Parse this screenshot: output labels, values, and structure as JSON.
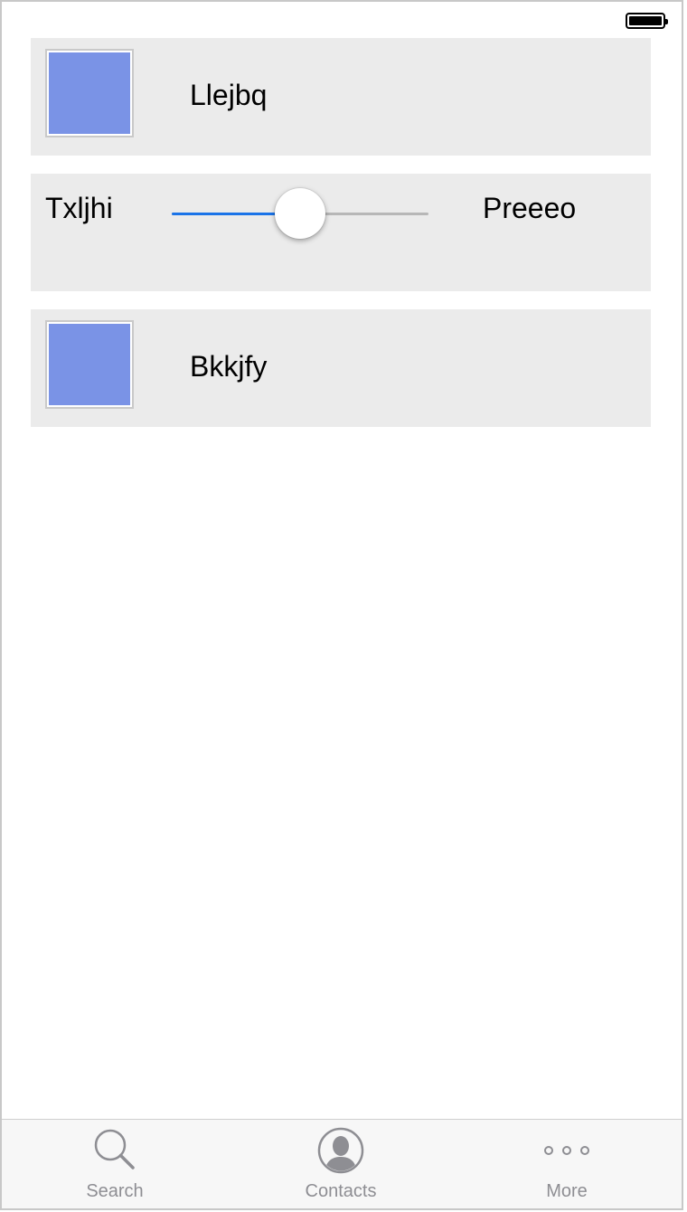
{
  "rows": [
    {
      "label": "Llejbq"
    },
    {
      "label": "Bkkjfy"
    }
  ],
  "slider": {
    "left_label": "Txljhi",
    "right_label": "Preeeo",
    "value": 0.5
  },
  "tabs": [
    {
      "label": "Search",
      "icon": "search-icon"
    },
    {
      "label": "Contacts",
      "icon": "contacts-icon"
    },
    {
      "label": "More",
      "icon": "more-icon"
    }
  ],
  "colors": {
    "thumbnail": "#7a93e6",
    "slider_active": "#1a73e8",
    "row_bg": "#ebebeb",
    "tab_icon": "#8e8e93"
  }
}
